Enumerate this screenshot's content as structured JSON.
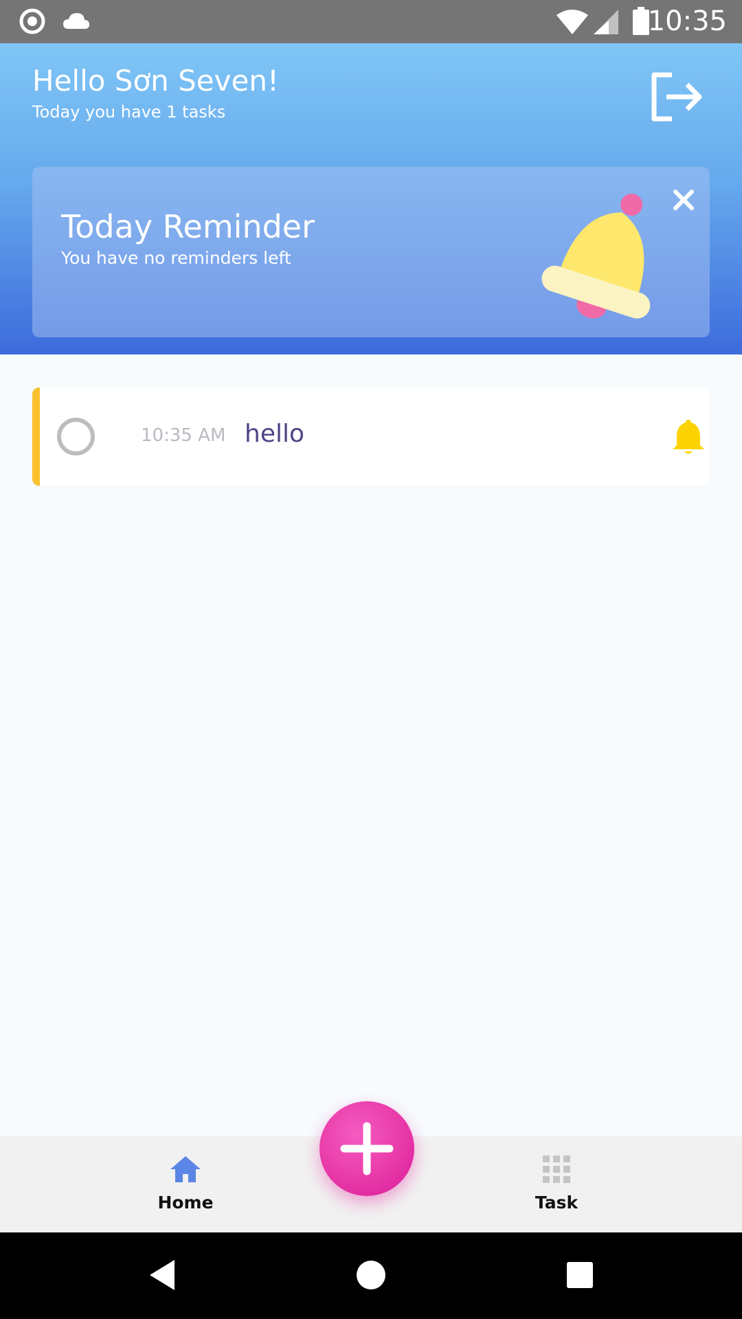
{
  "status_bar": {
    "time": "10:35",
    "icons": [
      "record-icon",
      "cloud-icon",
      "wifi-icon",
      "signal-icon",
      "battery-icon"
    ]
  },
  "header": {
    "greeting": "Hello Sơn Seven!",
    "subtitle": "Today you have 1 tasks",
    "logout_icon": "logout-icon"
  },
  "reminder": {
    "title": "Today Reminder",
    "subtitle": "You have no reminders left",
    "close_icon": "close-icon",
    "illustration": "bell-illustration"
  },
  "tasks": [
    {
      "time": "10:35 AM",
      "title": "hello",
      "accent_color": "#fbc02d",
      "completed": false,
      "reminder_icon": "bell-icon"
    }
  ],
  "bottom_nav": {
    "items": [
      {
        "label": "Home",
        "icon": "home-icon",
        "active": true
      },
      {
        "label": "Task",
        "icon": "grid-icon",
        "active": false
      }
    ],
    "fab_icon": "plus-icon"
  },
  "system_nav": {
    "buttons": [
      "back-icon",
      "home-circle-icon",
      "recents-icon"
    ]
  },
  "colors": {
    "header_top": "#80c6f6",
    "header_bottom": "#3d6bdc",
    "fab": "#e83aa8",
    "task_title": "#4c4586",
    "task_accent": "#fbc02d",
    "active_nav": "#5b86e5"
  }
}
